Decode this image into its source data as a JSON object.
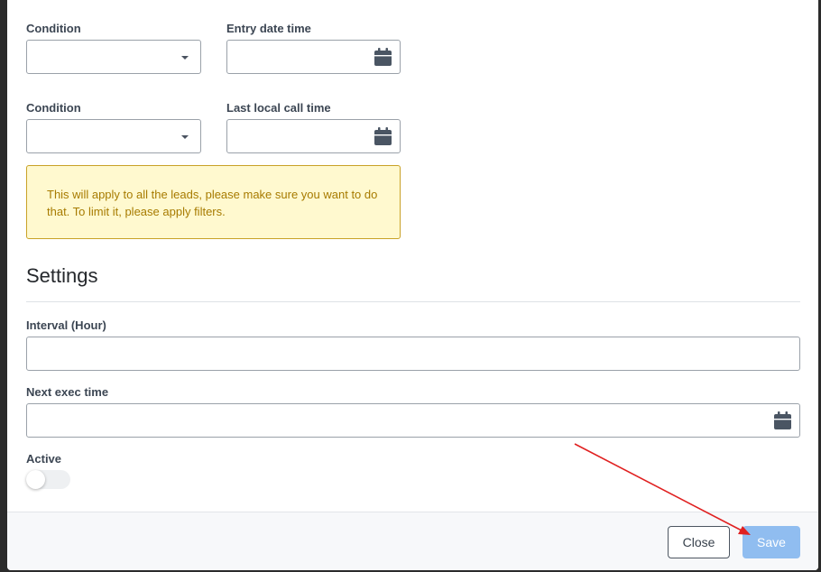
{
  "filters": {
    "condition1_label": "Condition",
    "entry_date_label": "Entry date time",
    "condition2_label": "Condition",
    "last_call_label": "Last local call time"
  },
  "alert": {
    "text": "This will apply to all the leads, please make sure you want to do that. To limit it, please apply filters."
  },
  "settings": {
    "title": "Settings",
    "interval_label": "Interval (Hour)",
    "next_exec_label": "Next exec time",
    "active_label": "Active"
  },
  "footer": {
    "close_label": "Close",
    "save_label": "Save"
  },
  "icons": {
    "select": "chevron-down-icon",
    "date": "calendar-icon"
  },
  "colors": {
    "alert_bg": "#fff9cf",
    "alert_text": "#a77b00",
    "save_bg": "#90bdf0",
    "annotation_arrow": "#e02020"
  }
}
